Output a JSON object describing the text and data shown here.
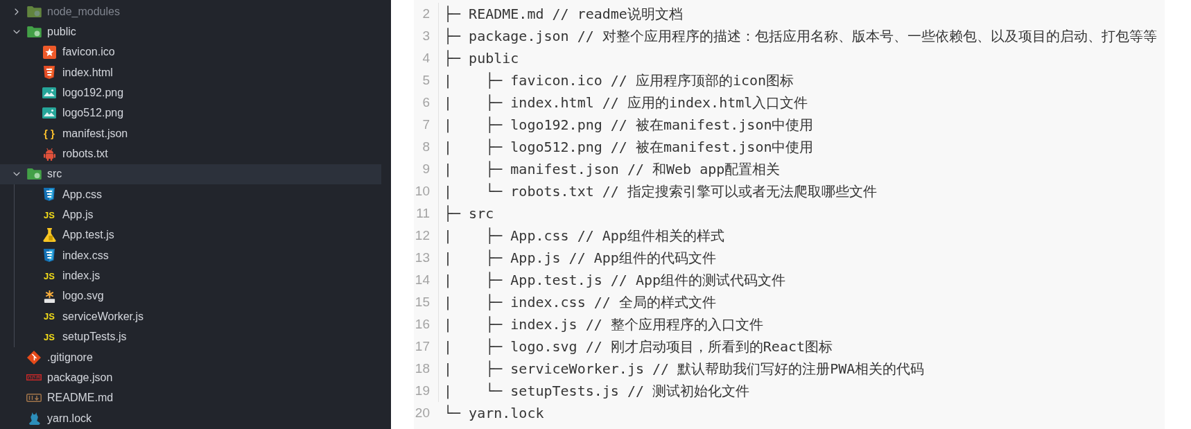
{
  "explorer": {
    "items": [
      {
        "name": "node_modules",
        "kind": "folder",
        "expanded": false,
        "selected": false,
        "ignored": true
      },
      {
        "name": "public",
        "kind": "folder",
        "expanded": true,
        "selected": false,
        "ignored": false,
        "children": [
          {
            "name": "favicon.ico",
            "kind": "ico",
            "selected": false,
            "ignored": false
          },
          {
            "name": "index.html",
            "kind": "html",
            "selected": false,
            "ignored": false
          },
          {
            "name": "logo192.png",
            "kind": "image",
            "selected": false,
            "ignored": false
          },
          {
            "name": "logo512.png",
            "kind": "image",
            "selected": false,
            "ignored": false
          },
          {
            "name": "manifest.json",
            "kind": "json",
            "glyph": "{ }",
            "selected": false,
            "ignored": false
          },
          {
            "name": "robots.txt",
            "kind": "robots",
            "selected": false,
            "ignored": false
          }
        ]
      },
      {
        "name": "src",
        "kind": "folder",
        "expanded": true,
        "selected": true,
        "ignored": false,
        "children": [
          {
            "name": "App.css",
            "kind": "css",
            "selected": false,
            "ignored": false
          },
          {
            "name": "App.js",
            "kind": "js",
            "glyph": "JS",
            "selected": false,
            "ignored": false
          },
          {
            "name": "App.test.js",
            "kind": "test",
            "selected": false,
            "ignored": false
          },
          {
            "name": "index.css",
            "kind": "css",
            "selected": false,
            "ignored": false
          },
          {
            "name": "index.js",
            "kind": "js",
            "glyph": "JS",
            "selected": false,
            "ignored": false
          },
          {
            "name": "logo.svg",
            "kind": "svg",
            "selected": false,
            "ignored": false
          },
          {
            "name": "serviceWorker.js",
            "kind": "js",
            "glyph": "JS",
            "selected": false,
            "ignored": false
          },
          {
            "name": "setupTests.js",
            "kind": "js",
            "glyph": "JS",
            "selected": false,
            "ignored": false
          }
        ]
      },
      {
        "name": ".gitignore",
        "kind": "git",
        "selected": false,
        "ignored": false
      },
      {
        "name": "package.json",
        "kind": "npm",
        "selected": false,
        "ignored": false
      },
      {
        "name": "README.md",
        "kind": "markdown",
        "selected": false,
        "ignored": false
      },
      {
        "name": "yarn.lock",
        "kind": "yarn",
        "selected": false,
        "ignored": false
      }
    ]
  },
  "code": {
    "lines": [
      {
        "number": "2",
        "text": "├─ README.md // readme说明文档"
      },
      {
        "number": "3",
        "text": "├─ package.json // 对整个应用程序的描述：包括应用名称、版本号、一些依赖包、以及项目的启动、打包等等"
      },
      {
        "number": "4",
        "text": "├─ public"
      },
      {
        "number": "5",
        "text": "|    ├─ favicon.ico // 应用程序顶部的icon图标"
      },
      {
        "number": "6",
        "text": "|    ├─ index.html // 应用的index.html入口文件"
      },
      {
        "number": "7",
        "text": "|    ├─ logo192.png // 被在manifest.json中使用"
      },
      {
        "number": "8",
        "text": "|    ├─ logo512.png // 被在manifest.json中使用"
      },
      {
        "number": "9",
        "text": "|    ├─ manifest.json // 和Web app配置相关"
      },
      {
        "number": "10",
        "text": "|    └─ robots.txt // 指定搜索引擎可以或者无法爬取哪些文件"
      },
      {
        "number": "11",
        "text": "├─ src"
      },
      {
        "number": "12",
        "text": "|    ├─ App.css // App组件相关的样式"
      },
      {
        "number": "13",
        "text": "|    ├─ App.js // App组件的代码文件"
      },
      {
        "number": "14",
        "text": "|    ├─ App.test.js // App组件的测试代码文件"
      },
      {
        "number": "15",
        "text": "|    ├─ index.css // 全局的样式文件"
      },
      {
        "number": "16",
        "text": "|    ├─ index.js // 整个应用程序的入口文件"
      },
      {
        "number": "17",
        "text": "|    ├─ logo.svg // 刚才启动项目，所看到的React图标"
      },
      {
        "number": "18",
        "text": "|    ├─ serviceWorker.js // 默认帮助我们写好的注册PWA相关的代码"
      },
      {
        "number": "19",
        "text": "|    └─ setupTests.js // 测试初始化文件"
      },
      {
        "number": "20",
        "text": "└─ yarn.lock"
      }
    ]
  }
}
